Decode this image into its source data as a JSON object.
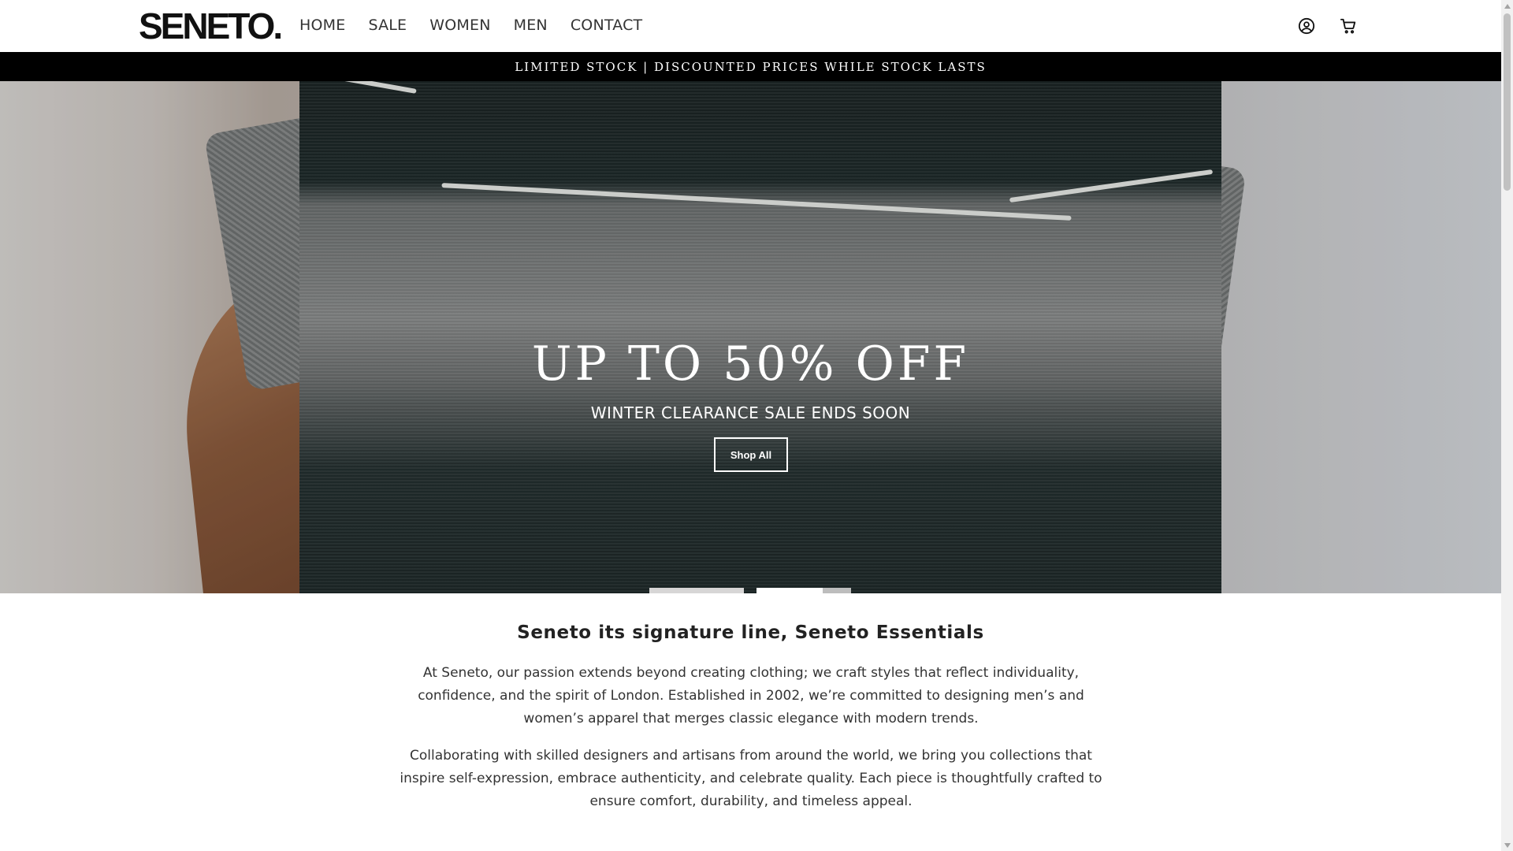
{
  "header": {
    "logo": "SENETO.",
    "nav": [
      "HOME",
      "SALE",
      "WOMEN",
      "MEN",
      "CONTACT"
    ],
    "icons": {
      "account": "account-circle-icon",
      "cart": "shopping-cart-icon"
    }
  },
  "announcement": "LIMITED STOCK | DISCOUNTED PRICES WHILE STOCK LASTS",
  "hero": {
    "title": "UP TO 50% OFF",
    "subtitle": "WINTER CLEARANCE SALE ENDS SOON",
    "button": "Shop All",
    "slides": 3,
    "active_slide": 2
  },
  "intro": {
    "title": "Seneto its signature line, Seneto Essentials",
    "paragraphs": [
      "At Seneto, our passion extends beyond creating clothing; we craft styles that reflect individuality, confidence, and the spirit of London. Established in 2002, we’re committed to designing men’s and women’s apparel that merges classic elegance with modern trends.",
      "Collaborating with skilled designers and artisans from around the world, we bring you collections that inspire self-expression, embrace authenticity, and celebrate quality. Each piece is thoughtfully crafted to ensure comfort, durability, and timeless appeal."
    ]
  },
  "colors": {
    "announcement_bg": "#000000",
    "text": "#222222",
    "accent": "#ffffff"
  }
}
